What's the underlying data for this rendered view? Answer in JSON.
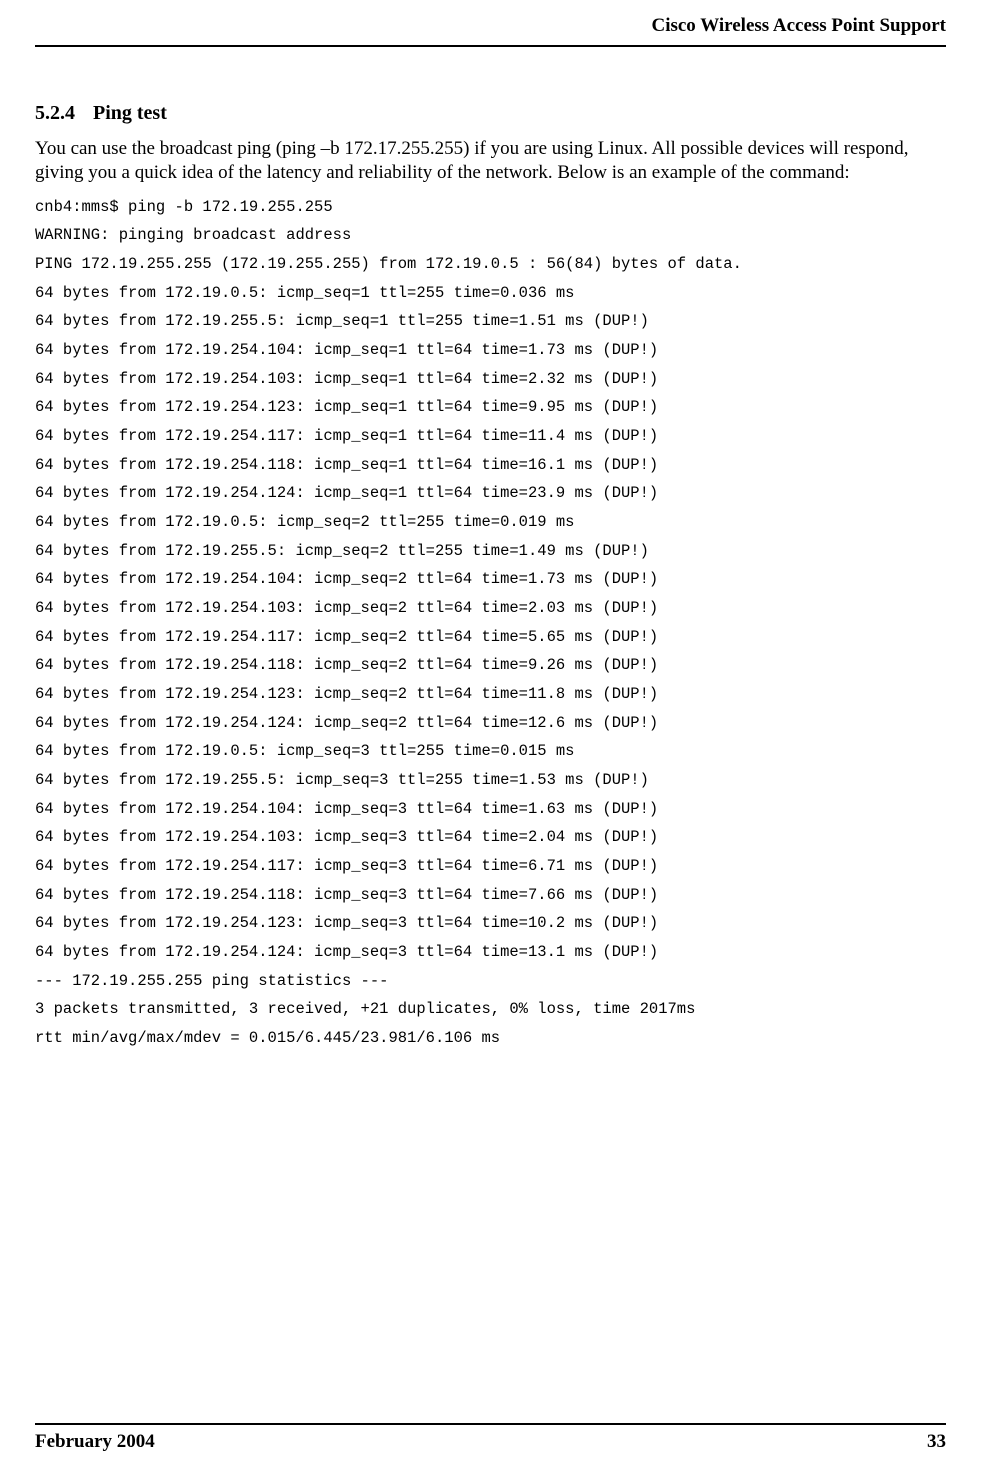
{
  "header": {
    "title": "Cisco Wireless Access Point Support"
  },
  "section": {
    "number": "5.2.4",
    "title": "Ping test",
    "paragraph": "You can use the broadcast ping (ping –b 172.17.255.255) if you are using Linux. All possible devices will respond, giving you a quick idea of the latency and reliability of the network. Below is an example of the command:"
  },
  "code": {
    "lines": [
      "cnb4:mms$ ping -b 172.19.255.255",
      "WARNING: pinging broadcast address",
      "PING 172.19.255.255 (172.19.255.255) from 172.19.0.5 : 56(84) bytes of data.",
      "64 bytes from 172.19.0.5: icmp_seq=1 ttl=255 time=0.036 ms",
      "64 bytes from 172.19.255.5: icmp_seq=1 ttl=255 time=1.51 ms (DUP!)",
      "64 bytes from 172.19.254.104: icmp_seq=1 ttl=64 time=1.73 ms (DUP!)",
      "64 bytes from 172.19.254.103: icmp_seq=1 ttl=64 time=2.32 ms (DUP!)",
      "64 bytes from 172.19.254.123: icmp_seq=1 ttl=64 time=9.95 ms (DUP!)",
      "64 bytes from 172.19.254.117: icmp_seq=1 ttl=64 time=11.4 ms (DUP!)",
      "64 bytes from 172.19.254.118: icmp_seq=1 ttl=64 time=16.1 ms (DUP!)",
      "64 bytes from 172.19.254.124: icmp_seq=1 ttl=64 time=23.9 ms (DUP!)",
      "64 bytes from 172.19.0.5: icmp_seq=2 ttl=255 time=0.019 ms",
      "64 bytes from 172.19.255.5: icmp_seq=2 ttl=255 time=1.49 ms (DUP!)",
      "64 bytes from 172.19.254.104: icmp_seq=2 ttl=64 time=1.73 ms (DUP!)",
      "64 bytes from 172.19.254.103: icmp_seq=2 ttl=64 time=2.03 ms (DUP!)",
      "64 bytes from 172.19.254.117: icmp_seq=2 ttl=64 time=5.65 ms (DUP!)",
      "64 bytes from 172.19.254.118: icmp_seq=2 ttl=64 time=9.26 ms (DUP!)",
      "64 bytes from 172.19.254.123: icmp_seq=2 ttl=64 time=11.8 ms (DUP!)",
      "64 bytes from 172.19.254.124: icmp_seq=2 ttl=64 time=12.6 ms (DUP!)",
      "64 bytes from 172.19.0.5: icmp_seq=3 ttl=255 time=0.015 ms",
      "64 bytes from 172.19.255.5: icmp_seq=3 ttl=255 time=1.53 ms (DUP!)",
      "64 bytes from 172.19.254.104: icmp_seq=3 ttl=64 time=1.63 ms (DUP!)",
      "64 bytes from 172.19.254.103: icmp_seq=3 ttl=64 time=2.04 ms (DUP!)",
      "64 bytes from 172.19.254.117: icmp_seq=3 ttl=64 time=6.71 ms (DUP!)",
      "64 bytes from 172.19.254.118: icmp_seq=3 ttl=64 time=7.66 ms (DUP!)",
      "64 bytes from 172.19.254.123: icmp_seq=3 ttl=64 time=10.2 ms (DUP!)",
      "64 bytes from 172.19.254.124: icmp_seq=3 ttl=64 time=13.1 ms (DUP!)",
      "--- 172.19.255.255 ping statistics ---",
      "3 packets transmitted, 3 received, +21 duplicates, 0% loss, time 2017ms",
      "rtt min/avg/max/mdev = 0.015/6.445/23.981/6.106 ms"
    ]
  },
  "footer": {
    "date": "February 2004",
    "page": "33"
  }
}
